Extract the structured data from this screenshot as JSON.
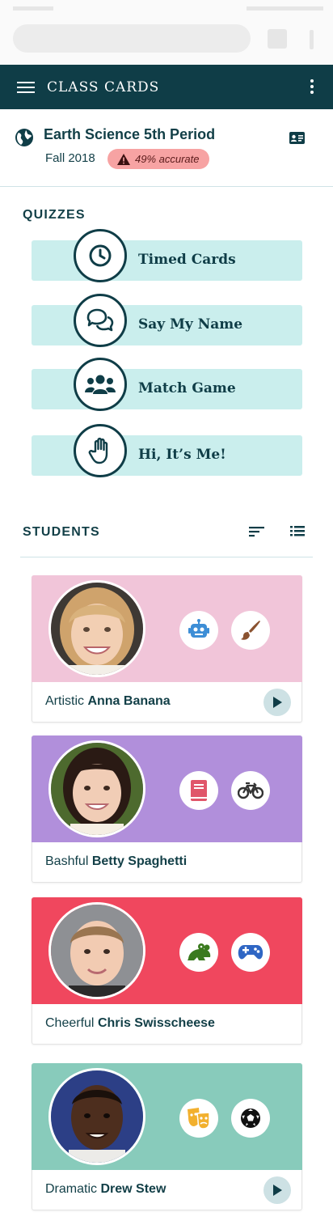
{
  "app": {
    "title": "CLASS CARDS"
  },
  "class_info": {
    "name": "Earth Science 5th Period",
    "term": "Fall 2018",
    "accuracy": "49% accurate"
  },
  "quizzes": {
    "heading": "QUIZZES",
    "items": [
      {
        "label": "Timed Cards",
        "icon": "clock-icon"
      },
      {
        "label": "Say My Name",
        "icon": "speech-bubbles-icon"
      },
      {
        "label": "Match Game",
        "icon": "people-group-icon"
      },
      {
        "label": "Hi, It’s Me!",
        "icon": "raised-hand-icon"
      }
    ]
  },
  "students": {
    "heading": "STUDENTS",
    "items": [
      {
        "adjective": "Artistic",
        "name": "Anna Banana",
        "color": "#f1c5d9",
        "interests": [
          "robot-icon",
          "paintbrush-icon"
        ],
        "has_play": true
      },
      {
        "adjective": "Bashful",
        "name": "Betty Spaghetti",
        "color": "#b18fdb",
        "interests": [
          "book-icon",
          "bicycle-icon"
        ],
        "has_play": false
      },
      {
        "adjective": "Cheerful",
        "name": "Chris Swisscheese",
        "color": "#f0475e",
        "interests": [
          "frog-icon",
          "gamepad-icon"
        ],
        "has_play": false
      },
      {
        "adjective": "Dramatic",
        "name": "Drew Stew",
        "color": "#88cbbb",
        "interests": [
          "theater-masks-icon",
          "soccer-ball-icon"
        ],
        "has_play": true
      }
    ]
  },
  "colors": {
    "primary": "#0f3d47",
    "quiz_bg": "#caeeed",
    "accuracy_badge": "#f7a3a3"
  }
}
